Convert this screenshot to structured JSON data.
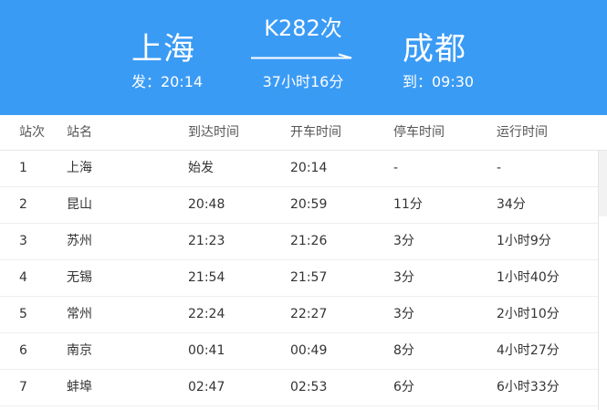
{
  "header": {
    "from_station": "上海",
    "depart_label": "发：20:14",
    "train_number": "K282次",
    "duration": "37小时16分",
    "to_station": "成都",
    "arrive_label": "到：09:30"
  },
  "table": {
    "columns": [
      "站次",
      "站名",
      "到达时间",
      "开车时间",
      "停车时间",
      "运行时间"
    ],
    "rows": [
      [
        "1",
        "上海",
        "始发",
        "20:14",
        "-",
        "-"
      ],
      [
        "2",
        "昆山",
        "20:48",
        "20:59",
        "11分",
        "34分"
      ],
      [
        "3",
        "苏州",
        "21:23",
        "21:26",
        "3分",
        "1小时9分"
      ],
      [
        "4",
        "无锡",
        "21:54",
        "21:57",
        "3分",
        "1小时40分"
      ],
      [
        "5",
        "常州",
        "22:24",
        "22:27",
        "3分",
        "2小时10分"
      ],
      [
        "6",
        "南京",
        "00:41",
        "00:49",
        "8分",
        "4小时27分"
      ],
      [
        "7",
        "蚌埠",
        "02:47",
        "02:53",
        "6分",
        "6小时33分"
      ]
    ]
  },
  "colors": {
    "header_bg": "#3a9bf5",
    "header_text": "#ffffff"
  }
}
